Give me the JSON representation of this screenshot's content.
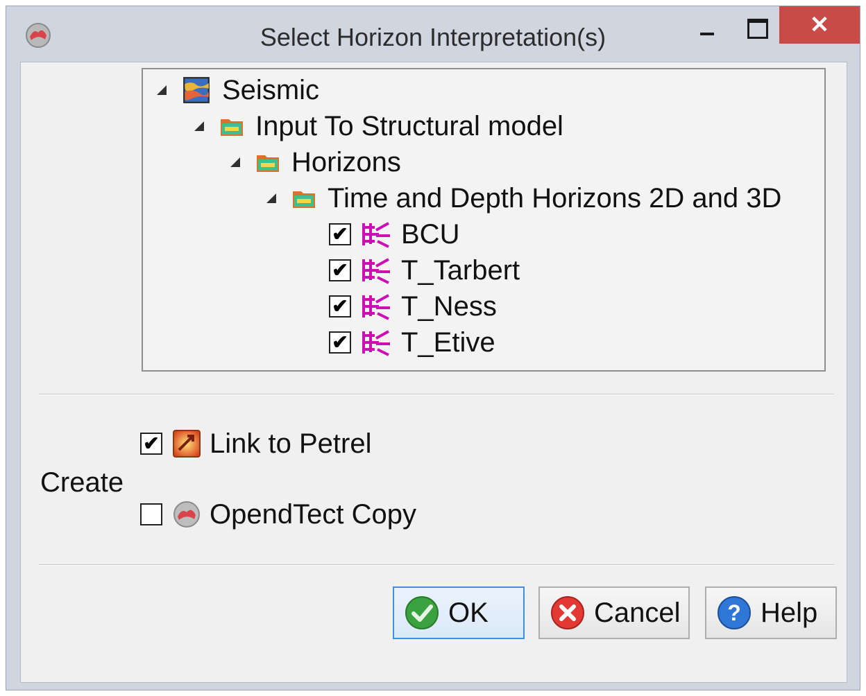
{
  "window": {
    "title": "Select Horizon Interpretation(s)",
    "close_glyph": "✕"
  },
  "tree": {
    "nodes": [
      {
        "label": "Seismic",
        "icon": "seismic-cube-icon"
      },
      {
        "label": "Input To Structural model",
        "icon": "folder-icon"
      },
      {
        "label": "Horizons",
        "icon": "folder-icon"
      },
      {
        "label": "Time and Depth Horizons 2D and 3D",
        "icon": "folder-icon"
      }
    ],
    "horizons": [
      {
        "label": "BCU",
        "checked": true,
        "check_glyph": "✔"
      },
      {
        "label": "T_Tarbert",
        "checked": true,
        "check_glyph": "✔"
      },
      {
        "label": "T_Ness",
        "checked": true,
        "check_glyph": "✔"
      },
      {
        "label": "T_Etive",
        "checked": true,
        "check_glyph": "✔"
      }
    ],
    "horizon_icon": "horizon-interpretation-icon",
    "horizon_color": "#cc0fb4"
  },
  "create": {
    "label": "Create",
    "link_to_petrel": {
      "label": "Link to Petrel",
      "checked": true,
      "check_glyph": "✔",
      "icon": "petrel-link-icon"
    },
    "opendtect_copy": {
      "label": "OpendTect Copy",
      "checked": false,
      "check_glyph": "",
      "icon": "opendtect-icon"
    }
  },
  "buttons": {
    "ok": "OK",
    "cancel": "Cancel",
    "help": "Help"
  },
  "colors": {
    "accent": "#3c8fe0",
    "close_button": "#c84b47",
    "ok_green": "#3aa23f",
    "cancel_red": "#e23a32",
    "help_blue": "#2f77d6"
  }
}
